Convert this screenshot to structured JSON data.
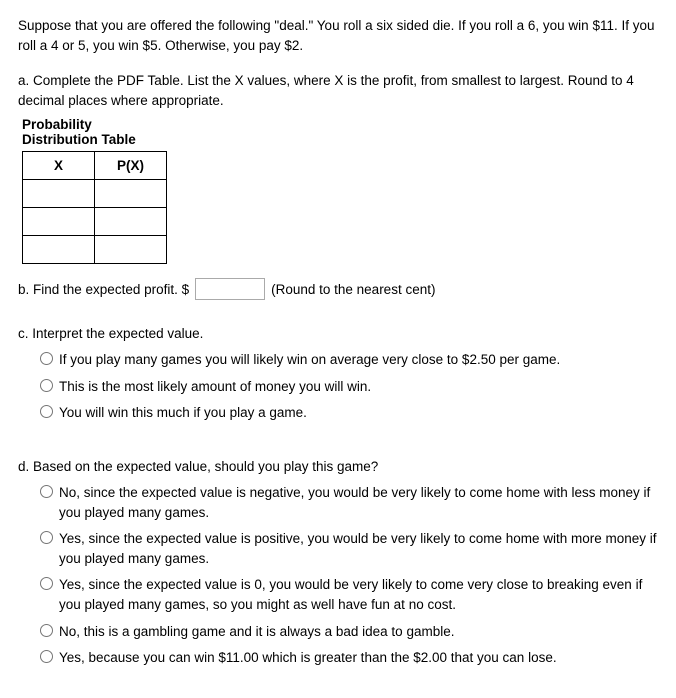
{
  "intro": {
    "text": "Suppose that you are offered the following \"deal.\" You roll a six sided die. If you roll a 6, you win $11. If you roll a 4 or 5, you win $5. Otherwise, you pay $2."
  },
  "part_a": {
    "label": "a. Complete the PDF Table. List the X values, where X is the profit, from smallest to largest. Round to 4 decimal places where appropriate.",
    "prob_label": "Probability",
    "table_label": "Distribution Table",
    "col_x": "X",
    "col_px": "P(X)",
    "rows": [
      {
        "x": "",
        "px": ""
      },
      {
        "x": "",
        "px": ""
      },
      {
        "x": "",
        "px": ""
      }
    ]
  },
  "part_b": {
    "label": "b. Find the expected profit. $",
    "suffix": "(Round to the nearest cent)",
    "value": ""
  },
  "part_c": {
    "label": "c. Interpret the expected value.",
    "options": [
      "If you play many games you will likely win on average very close to $2.50 per game.",
      "This is the most likely amount of money you will win.",
      "You will win this much if you play a game."
    ]
  },
  "part_d": {
    "label": "d. Based on the expected value, should you play this game?",
    "options": [
      "No, since the expected value is negative, you would be very likely to come home with less money if you played many games.",
      "Yes, since the expected value is positive, you would be very likely to come home with more money if you played many games.",
      "Yes, since the expected value is 0, you would be very likely to come very close to breaking even if you played many games, so you might as well have fun at no cost.",
      "No, this is a gambling game and it is always a bad idea to gamble.",
      "Yes, because you can win $11.00 which is greater than the $2.00 that you can lose."
    ]
  }
}
